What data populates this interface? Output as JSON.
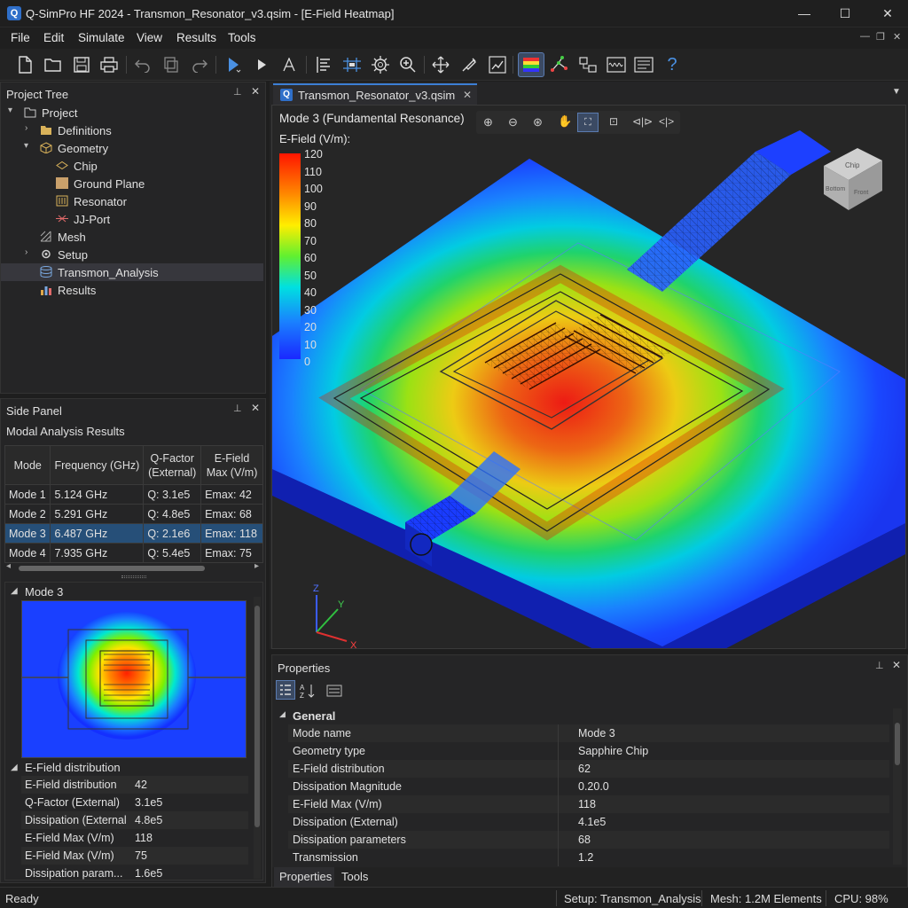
{
  "window": {
    "title": "Q-SimPro HF 2024 - Transmon_Resonator_v3.qsim - [E-Field Heatmap]",
    "app_icon": "Q",
    "minimize": "—",
    "maximize": "☐",
    "close": "✕"
  },
  "menu": [
    "File",
    "Edit",
    "Simulate",
    "View",
    "Results",
    "Tools"
  ],
  "toolbar_icons": [
    "new-file-icon",
    "open-folder-icon",
    "save-icon",
    "print-icon",
    "undo-icon",
    "copy-icon",
    "redo-icon",
    "run-simulation-icon",
    "play-icon",
    "text-icon",
    "align-icon",
    "mesh-icon",
    "settings-gear-icon",
    "zoom-icon",
    "move-icon",
    "probe-icon",
    "chart-icon",
    "heatmap-icon",
    "network-icon",
    "layers-icon",
    "waveform-icon",
    "report-icon",
    "help-icon"
  ],
  "project_tree": {
    "title": "Project Tree",
    "items": [
      {
        "label": "Project",
        "icon": "folder-icon"
      },
      {
        "label": "Definitions",
        "icon": "folder-icon"
      },
      {
        "label": "Geometry",
        "icon": "cube-icon"
      },
      {
        "label": "Chip",
        "icon": "chip-icon"
      },
      {
        "label": "Ground Plane",
        "icon": "plane-icon"
      },
      {
        "label": "Resonator",
        "icon": "resonator-icon"
      },
      {
        "label": "JJ-Port",
        "icon": "port-icon"
      },
      {
        "label": "Mesh",
        "icon": "mesh-icon"
      },
      {
        "label": "Setup",
        "icon": "gear-icon"
      },
      {
        "label": "Transmon_Analysis",
        "icon": "database-icon"
      },
      {
        "label": "Results",
        "icon": "bar-chart-icon"
      }
    ]
  },
  "side_panel": {
    "title": "Side Panel",
    "subtitle": "Modal Analysis Results",
    "columns": [
      "Mode",
      "Frequency (GHz)",
      "Q-Factor (External)",
      "E-Field Max (V/m)"
    ],
    "rows": [
      [
        "Mode 1",
        "5.124 GHz",
        "Q: 3.1e5",
        "Emax: 42"
      ],
      [
        "Mode 2",
        "5.291 GHz",
        "Q: 4.8e5",
        "Emax: 68"
      ],
      [
        "Mode 3",
        "6.487 GHz",
        "Q: 2.1e6",
        "Emax: 118"
      ],
      [
        "Mode 4",
        "7.935 GHz",
        "Q: 5.4e5",
        "Emax: 75"
      ]
    ],
    "selected_row": 2,
    "preview_title": "Mode 3",
    "details_title": "E-Field distribution",
    "details": [
      {
        "label": "E-Field distribution",
        "value": "42"
      },
      {
        "label": "Q-Factor (External)",
        "value": "3.1e5"
      },
      {
        "label": "Dissipation (External",
        "value": "4.8e5"
      },
      {
        "label": "E-Field Max (V/m)",
        "value": "118"
      },
      {
        "label": "E-Field Max (V/m)",
        "value": "75"
      },
      {
        "label": "Dissipation param...",
        "value": "1.6e5"
      }
    ]
  },
  "viewport": {
    "tab": "Transmon_Resonator_v3.qsim",
    "mode_label": "Mode 3 (Fundamental Resonance)",
    "legend_title": "E-Field (V/m):",
    "legend_ticks": [
      "120",
      "110",
      "100",
      "90",
      "80",
      "70",
      "60",
      "50",
      "40",
      "30",
      "20",
      "10",
      "0"
    ],
    "view_cube_labels": [
      "Chip",
      "Bottom",
      "Front"
    ],
    "axes": {
      "z": "Z",
      "y": "Y",
      "x": "X"
    }
  },
  "properties": {
    "title": "Properties",
    "group": "General",
    "rows": [
      {
        "label": "Mode name",
        "value": "Mode 3"
      },
      {
        "label": "Geometry type",
        "value": "Sapphire Chip"
      },
      {
        "label": "E-Field distribution",
        "value": "62"
      },
      {
        "label": "Dissipation Magnitude",
        "value": "0.20.0"
      },
      {
        "label": "E-Field Max (V/m)",
        "value": "118"
      },
      {
        "label": "Dissipation (External)",
        "value": "4.1e5"
      },
      {
        "label": "Dissipation parameters",
        "value": "68"
      },
      {
        "label": "Transmission",
        "value": "1.2"
      }
    ],
    "tabs": [
      "Properties",
      "Tools"
    ]
  },
  "status": {
    "left": "Ready",
    "setup": "Setup: Transmon_Analysis",
    "mesh": "Mesh: 1.2M Elements",
    "cpu": "CPU: 98%"
  }
}
